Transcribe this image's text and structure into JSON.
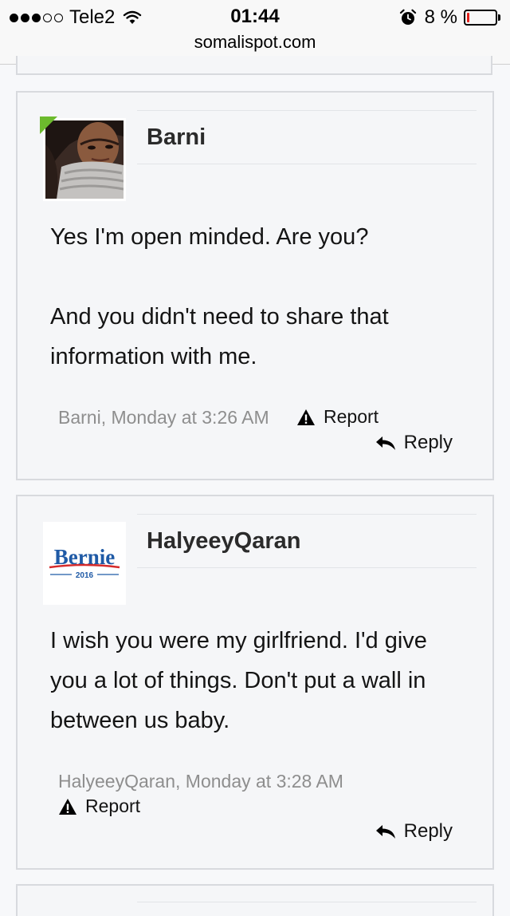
{
  "status_bar": {
    "signal_dots": [
      true,
      true,
      true,
      false,
      false
    ],
    "carrier": "Tele2",
    "time": "01:44",
    "battery_percent_label": "8 %",
    "battery_level": 0.08,
    "battery_color": "#e3201b",
    "url": "somalispot.com"
  },
  "messages": [
    {
      "username": "Barni",
      "online": true,
      "online_color": "#6cba2d",
      "avatar": "user-photo",
      "body": [
        "Yes I'm open minded. Are you?",
        "And you didn't need to share that information with me."
      ],
      "meta": "Barni, Monday at 3:26 AM",
      "report_label": "Report",
      "reply_label": "Reply"
    },
    {
      "username": "HalyeeyQaran",
      "online": false,
      "avatar": "bernie-2016-logo",
      "avatar_logo_text": "Bernie",
      "avatar_logo_year": "2016",
      "avatar_logo_colors": {
        "text": "#1f5aa6",
        "stripe": "#d52b2b"
      },
      "body": [
        "I wish you were my girlfriend. I'd give you a lot of things. Don't put a wall in between us baby."
      ],
      "meta": "HalyeeyQaran, Monday at 3:28 AM",
      "report_label": "Report",
      "reply_label": "Reply"
    }
  ]
}
